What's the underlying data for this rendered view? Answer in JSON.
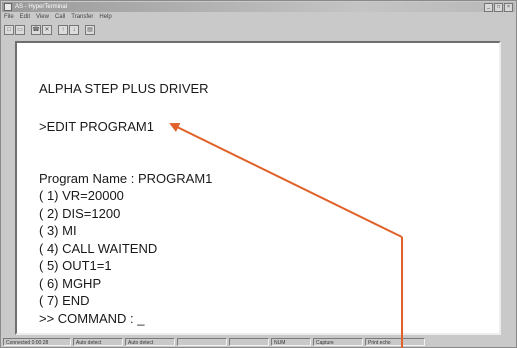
{
  "window": {
    "title": "AS - HyperTerminal",
    "controls": [
      "_",
      "□",
      "×"
    ]
  },
  "menu": {
    "items": [
      "File",
      "Edit",
      "View",
      "Call",
      "Transfer",
      "Help"
    ]
  },
  "toolbar": {
    "buttons": [
      {
        "icon": "new-connection-icon",
        "glyph": "□"
      },
      {
        "icon": "open-icon",
        "glyph": "▭"
      },
      {
        "icon": "call-icon",
        "glyph": "☎"
      },
      {
        "icon": "disconnect-icon",
        "glyph": "✕"
      },
      {
        "icon": "send-file-icon",
        "glyph": "↑"
      },
      {
        "icon": "receive-file-icon",
        "glyph": "↓"
      },
      {
        "icon": "properties-icon",
        "glyph": "▤"
      }
    ]
  },
  "terminal": {
    "header": "ALPHA STEP PLUS DRIVER",
    "edit_command": ">EDIT PROGRAM1",
    "program_name": "Program Name : PROGRAM1",
    "program_lines": [
      "( 1) VR=20000",
      "( 2) DIS=1200",
      "( 3) MI",
      "( 4) CALL WAITEND",
      "( 5) OUT1=1",
      "( 6) MGHP",
      "( 7) END"
    ],
    "prompt": ">> COMMAND : _"
  },
  "statusbar": {
    "cells": [
      "Connected 0:00:28",
      "Auto detect",
      "Auto detect",
      "",
      "",
      "NUM",
      "Capture",
      "Print echo"
    ]
  },
  "annotation": {
    "arrow_color": "#e0622a"
  }
}
